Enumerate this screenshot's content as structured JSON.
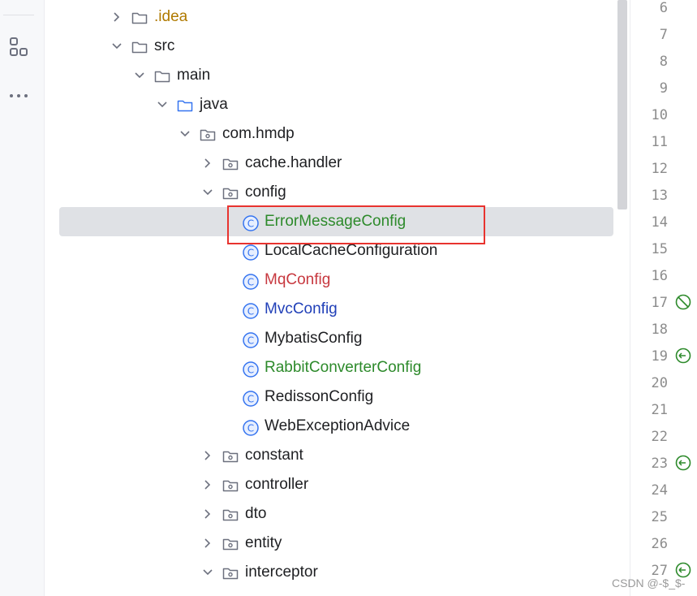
{
  "tree": [
    {
      "label": ".idea",
      "depth": 0,
      "type": "folder",
      "expanded": false,
      "color": "#b07a00"
    },
    {
      "label": "src",
      "depth": 0,
      "type": "folder",
      "expanded": true,
      "color": "#1e1f22"
    },
    {
      "label": "main",
      "depth": 1,
      "type": "folder",
      "expanded": true,
      "color": "#1e1f22"
    },
    {
      "label": "java",
      "depth": 2,
      "type": "source-folder",
      "expanded": true,
      "color": "#1e1f22"
    },
    {
      "label": "com.hmdp",
      "depth": 3,
      "type": "package",
      "expanded": true,
      "color": "#1e1f22"
    },
    {
      "label": "cache.handler",
      "depth": 4,
      "type": "package",
      "expanded": false,
      "color": "#1e1f22"
    },
    {
      "label": "config",
      "depth": 4,
      "type": "package",
      "expanded": true,
      "color": "#1e1f22"
    },
    {
      "label": "ErrorMessageConfig",
      "depth": 5,
      "type": "class",
      "color": "#2d8a2b",
      "selected": true
    },
    {
      "label": "LocalCacheConfiguration",
      "depth": 5,
      "type": "class",
      "color": "#1e1f22"
    },
    {
      "label": "MqConfig",
      "depth": 5,
      "type": "class",
      "color": "#c7383f"
    },
    {
      "label": "MvcConfig",
      "depth": 5,
      "type": "class",
      "color": "#2140b8"
    },
    {
      "label": "MybatisConfig",
      "depth": 5,
      "type": "class",
      "color": "#1e1f22"
    },
    {
      "label": "RabbitConverterConfig",
      "depth": 5,
      "type": "class",
      "color": "#2d8a2b"
    },
    {
      "label": "RedissonConfig",
      "depth": 5,
      "type": "class",
      "color": "#1e1f22"
    },
    {
      "label": "WebExceptionAdvice",
      "depth": 5,
      "type": "class",
      "color": "#1e1f22"
    },
    {
      "label": "constant",
      "depth": 4,
      "type": "package",
      "expanded": false,
      "color": "#1e1f22"
    },
    {
      "label": "controller",
      "depth": 4,
      "type": "package",
      "expanded": false,
      "color": "#1e1f22"
    },
    {
      "label": "dto",
      "depth": 4,
      "type": "package",
      "expanded": false,
      "color": "#1e1f22"
    },
    {
      "label": "entity",
      "depth": 4,
      "type": "package",
      "expanded": false,
      "color": "#1e1f22"
    },
    {
      "label": "interceptor",
      "depth": 4,
      "type": "package",
      "expanded": true,
      "color": "#1e1f22"
    }
  ],
  "gutter": {
    "line_numbers": [
      "6",
      "7",
      "8",
      "9",
      "10",
      "11",
      "12",
      "13",
      "14",
      "15",
      "16",
      "17",
      "18",
      "19",
      "20",
      "21",
      "22",
      "23",
      "24",
      "25",
      "26",
      "27"
    ],
    "markers": [
      {
        "line": "17",
        "icon": "no-bean-icon"
      },
      {
        "line": "19",
        "icon": "override-icon"
      },
      {
        "line": "23",
        "icon": "override-icon"
      },
      {
        "line": "27",
        "icon": "override-icon"
      }
    ]
  },
  "sidebar": {
    "icons": [
      "structure-icon",
      "more-icon"
    ]
  },
  "watermark": "CSDN @-$_$-",
  "colors": {
    "selection": "#dfe1e5",
    "highlight_border": "#e8332f",
    "class_icon": "#3574f0"
  }
}
